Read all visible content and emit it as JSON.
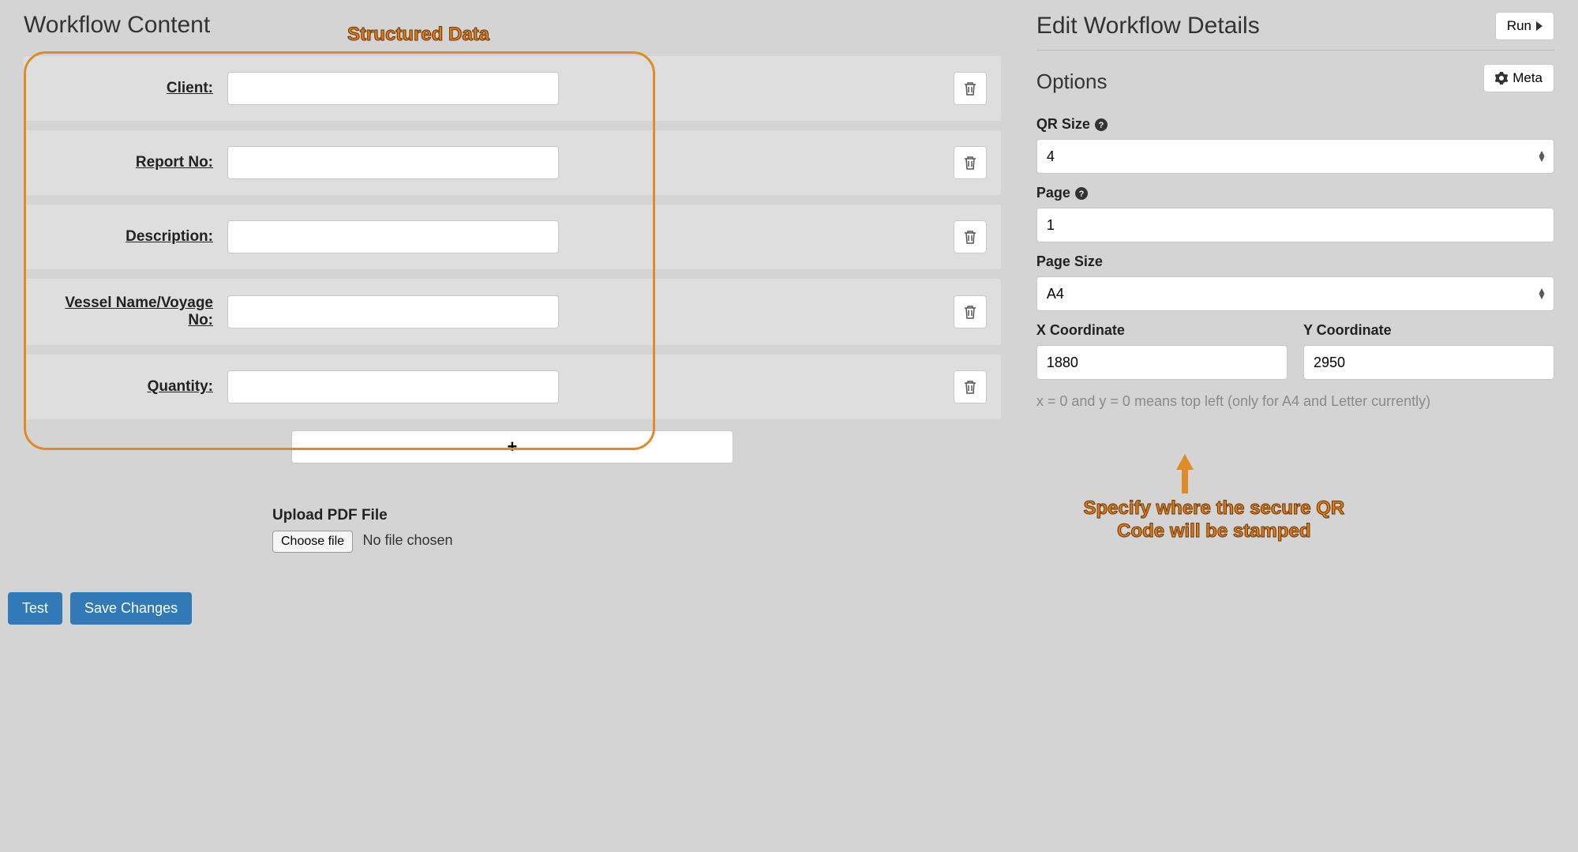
{
  "left": {
    "title": "Workflow Content",
    "fields": [
      {
        "label": "Client:",
        "value": ""
      },
      {
        "label": "Report No:",
        "value": ""
      },
      {
        "label": "Description:",
        "value": ""
      },
      {
        "label": "Vessel Name/Voyage No:",
        "value": ""
      },
      {
        "label": "Quantity:",
        "value": ""
      }
    ],
    "add_glyph": "+",
    "upload_label": "Upload PDF File",
    "choose_file_label": "Choose file",
    "no_file_text": "No file chosen",
    "test_btn": "Test",
    "save_btn": "Save Changes"
  },
  "right": {
    "title": "Edit Workflow Details",
    "run_btn": "Run",
    "options_heading": "Options",
    "meta_btn": "Meta",
    "qr_size_label": "QR Size",
    "qr_size_value": "4",
    "page_label": "Page",
    "page_value": "1",
    "page_size_label": "Page Size",
    "page_size_value": "A4",
    "x_label": "X Coordinate",
    "x_value": "1880",
    "y_label": "Y Coordinate",
    "y_value": "2950",
    "hint": "x = 0 and y = 0 means top left (only for A4 and Letter currently)"
  },
  "annotations": {
    "structured_data": "Structured Data",
    "qr_position": "Specify where the secure QR Code will be stamped"
  }
}
